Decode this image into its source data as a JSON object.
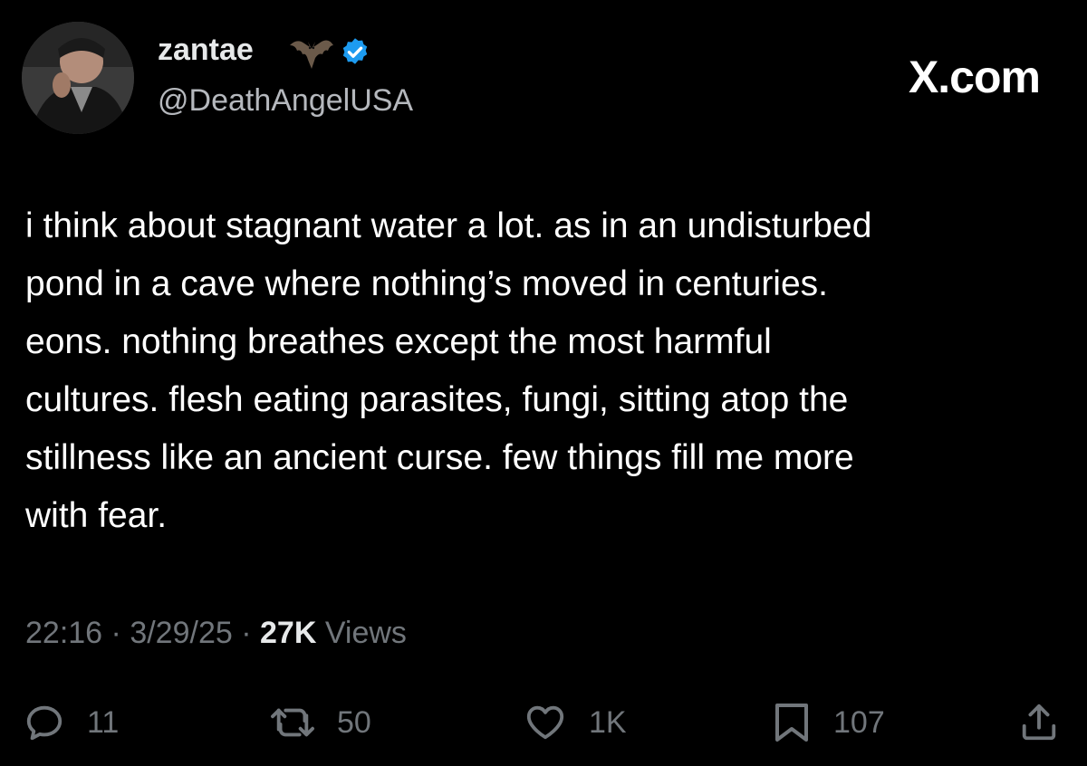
{
  "author": {
    "display_name": "zantae",
    "handle": "@DeathAngelUSA",
    "emoji": "bat-icon",
    "verified_badge": "verified-icon",
    "verified_color": "#1d9bf0"
  },
  "brand": {
    "logo_text": "X.com"
  },
  "post": {
    "text": "i think about stagnant water a lot. as in an undisturbed\npond in a cave where nothing’s moved in centuries.\neons. nothing breathes except the most harmful\ncultures. flesh eating parasites, fungi, sitting atop the\nstillness like an ancient curse. few things fill me more\nwith fear."
  },
  "meta": {
    "time": "22:16",
    "separator": "·",
    "date": "3/29/25",
    "views_count": "27K",
    "views_label": "Views"
  },
  "actions": {
    "reply": {
      "icon": "reply-icon",
      "count": "11"
    },
    "repost": {
      "icon": "repost-icon",
      "count": "50"
    },
    "like": {
      "icon": "heart-icon",
      "count": "1K"
    },
    "bookmark": {
      "icon": "bookmark-icon",
      "count": "107"
    },
    "share": {
      "icon": "share-icon"
    }
  },
  "colors": {
    "background": "#000000",
    "text_primary": "#ffffff",
    "text_secondary": "#71767b",
    "accent_verified": "#1d9bf0"
  }
}
